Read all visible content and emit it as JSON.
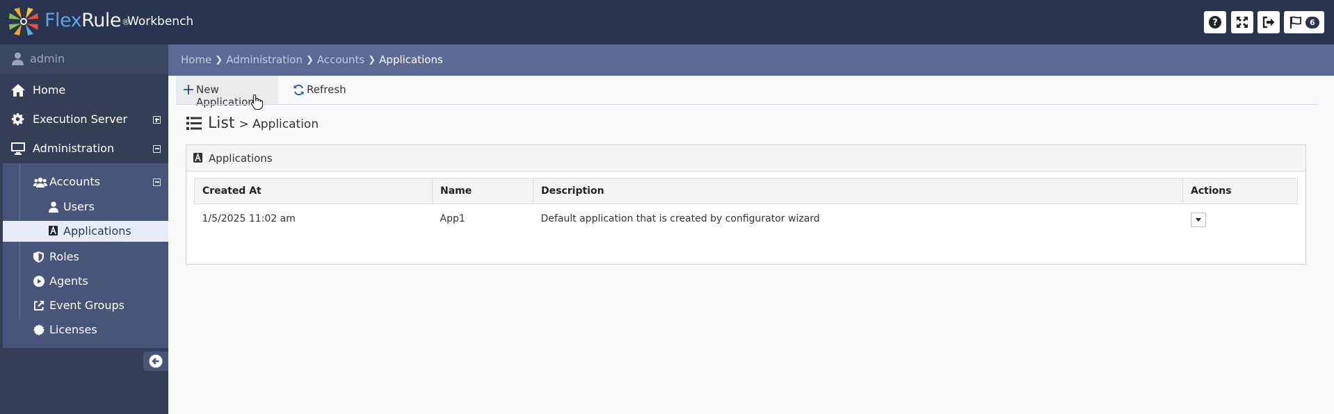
{
  "app": {
    "brand_flex": "Flex",
    "brand_rule": "Rule",
    "brand_reg": "®",
    "product": "Workbench",
    "notification_count": "6"
  },
  "colors": {
    "topbar": "#283450",
    "sidebar": "#343f57",
    "breadcrumb_bar": "#5b6a95",
    "active_item": "#e7ebf8"
  },
  "sidebar": {
    "user": "admin",
    "items": [
      {
        "label": "Home",
        "icon": "home-icon"
      },
      {
        "label": "Execution Server",
        "icon": "gear-icon",
        "toggle": "expand"
      },
      {
        "label": "Administration",
        "icon": "monitor-icon",
        "toggle": "collapse"
      }
    ],
    "sub": {
      "accounts": "Accounts",
      "users": "Users",
      "applications": "Applications",
      "roles": "Roles",
      "agents": "Agents",
      "event_groups": "Event Groups",
      "licenses": "Licenses"
    }
  },
  "breadcrumb": [
    "Home",
    "Administration",
    "Accounts",
    "Applications"
  ],
  "toolbar": {
    "new_label": "New Application",
    "refresh_label": "Refresh"
  },
  "page": {
    "title": "List",
    "subtitle": "> Application"
  },
  "panel": {
    "title": "Applications",
    "columns": [
      "Created At",
      "Name",
      "Description",
      "Actions"
    ],
    "rows": [
      {
        "created_at": "1/5/2025 11:02 am",
        "name": "App1",
        "description": "Default application that is created by configurator wizard"
      }
    ]
  }
}
